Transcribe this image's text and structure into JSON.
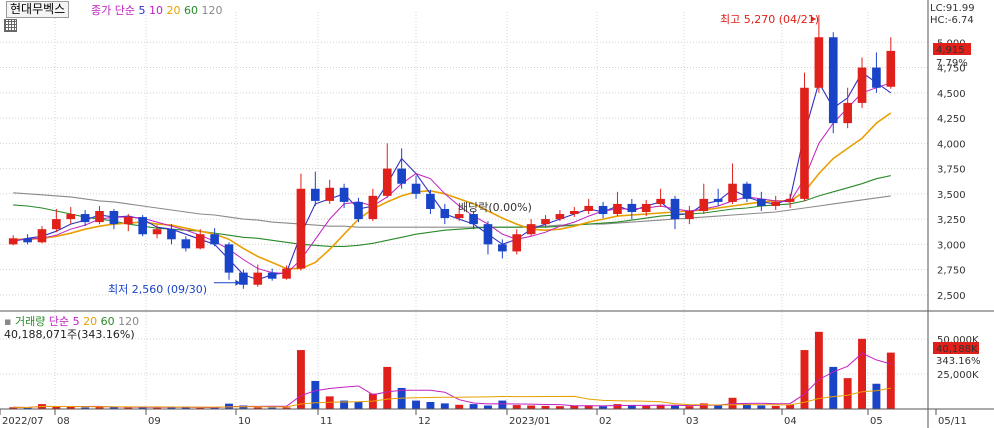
{
  "stock_name": "현대무벡스",
  "price_legend": {
    "type_label": "종가 단순",
    "periods": [
      "5",
      "10",
      "20",
      "60",
      "120"
    ]
  },
  "volume_legend": {
    "name": "거래량",
    "type_label": "단순",
    "periods": [
      "5",
      "20",
      "60",
      "120"
    ]
  },
  "volume_summary": "40,188,071주(343.16%)",
  "lc_label": "LC:91.99",
  "hc_label": "HC:-6.74",
  "max_annotation": "최고 5,270 (04/21)",
  "min_annotation": "최저 2,560 (09/30)",
  "ref_annotation": "배당락(0.00%)",
  "current_price_tag": "4,915",
  "current_change_tag": "7.79%",
  "current_volume_tag": "40,188K",
  "current_volume_ratio_tag": "343.16%",
  "colors": {
    "up": "#e0201b",
    "down": "#1a44c8",
    "ma5": "#3030c0",
    "ma10": "#c020c0",
    "ma20": "#e8a000",
    "ma60": "#2a8a2a",
    "ma120": "#8a8a8a"
  },
  "chart_data": [
    {
      "type": "candlestick",
      "ylim": [
        2350,
        5300
      ],
      "y_ticks": [
        "5,000",
        "4,750",
        "4,500",
        "4,250",
        "4,000",
        "3,750",
        "3,500",
        "3,250",
        "3,000",
        "2,750",
        "2,500"
      ],
      "y_tick_values": [
        5000,
        4750,
        4500,
        4250,
        4000,
        3750,
        3500,
        3250,
        3000,
        2750,
        2500
      ],
      "x_ticks": [
        "2022/07",
        "08",
        "09",
        "10",
        "11",
        "12",
        "2023/01",
        "02",
        "03",
        "04",
        "05",
        "05/11"
      ],
      "high": 5270,
      "low": 2560,
      "close": 4915,
      "series": [
        {
          "name": "5",
          "values": [
            3030,
            3060,
            3080,
            3130,
            3200,
            3240,
            3290,
            3270,
            3280,
            3250,
            3170,
            3150,
            3100,
            3050,
            3000,
            2850,
            2700,
            2650,
            2700,
            2720,
            3100,
            3400,
            3450,
            3500,
            3350,
            3380,
            3600,
            3850,
            3700,
            3500,
            3300,
            3250,
            3200,
            3100,
            3000,
            3050,
            3150,
            3200,
            3250,
            3300,
            3350,
            3320,
            3380,
            3330,
            3380,
            3420,
            3300,
            3300,
            3400,
            3430,
            3540,
            3470,
            3420,
            3400,
            3450,
            4100,
            4600,
            4350,
            4450,
            4700,
            4600,
            4500
          ]
        },
        {
          "name": "10",
          "values": [
            3040,
            3050,
            3060,
            3090,
            3150,
            3190,
            3250,
            3270,
            3270,
            3260,
            3220,
            3180,
            3140,
            3090,
            3030,
            2950,
            2850,
            2760,
            2720,
            2710,
            2850,
            3050,
            3250,
            3400,
            3420,
            3380,
            3470,
            3600,
            3700,
            3650,
            3500,
            3380,
            3280,
            3200,
            3100,
            3050,
            3080,
            3120,
            3180,
            3220,
            3280,
            3330,
            3350,
            3350,
            3360,
            3380,
            3350,
            3330,
            3350,
            3380,
            3430,
            3470,
            3450,
            3430,
            3420,
            3650,
            4000,
            4200,
            4350,
            4500,
            4550,
            4600
          ]
        }
      ],
      "moving_averages": {
        "ma5": [
          3030,
          3060,
          3080,
          3130,
          3200,
          3240,
          3290,
          3270,
          3280,
          3250,
          3170,
          3150,
          3100,
          3050,
          3000,
          2850,
          2700,
          2650,
          2700,
          2720,
          3100,
          3400,
          3450,
          3500,
          3350,
          3380,
          3600,
          3850,
          3700,
          3500,
          3300,
          3250,
          3200,
          3100,
          3000,
          3050,
          3150,
          3200,
          3250,
          3300,
          3350,
          3320,
          3380,
          3330,
          3380,
          3420,
          3300,
          3300,
          3400,
          3430,
          3540,
          3470,
          3420,
          3400,
          3450,
          4100,
          4600,
          4350,
          4450,
          4700,
          4600,
          4500
        ],
        "ma20": [
          3050,
          3050,
          3060,
          3080,
          3110,
          3150,
          3180,
          3200,
          3210,
          3220,
          3200,
          3190,
          3160,
          3130,
          3100,
          3050,
          2960,
          2880,
          2820,
          2760,
          2760,
          2820,
          2950,
          3100,
          3250,
          3350,
          3420,
          3480,
          3520,
          3530,
          3500,
          3450,
          3400,
          3330,
          3260,
          3200,
          3150,
          3140,
          3150,
          3180,
          3220,
          3250,
          3280,
          3290,
          3300,
          3310,
          3320,
          3330,
          3340,
          3360,
          3380,
          3400,
          3420,
          3430,
          3430,
          3520,
          3700,
          3850,
          3950,
          4050,
          4200,
          4300
        ],
        "ma60": [
          3390,
          3380,
          3360,
          3330,
          3300,
          3270,
          3250,
          3230,
          3200,
          3180,
          3160,
          3150,
          3140,
          3130,
          3110,
          3090,
          3070,
          3060,
          3040,
          3020,
          3000,
          2990,
          2980,
          2980,
          2990,
          3010,
          3040,
          3070,
          3100,
          3120,
          3140,
          3150,
          3160,
          3170,
          3170,
          3170,
          3170,
          3170,
          3180,
          3190,
          3200,
          3210,
          3220,
          3240,
          3260,
          3280,
          3290,
          3300,
          3310,
          3330,
          3350,
          3360,
          3380,
          3390,
          3400,
          3430,
          3480,
          3520,
          3560,
          3600,
          3650,
          3680
        ],
        "ma120": [
          3510,
          3500,
          3490,
          3480,
          3470,
          3450,
          3430,
          3420,
          3400,
          3380,
          3360,
          3340,
          3320,
          3300,
          3290,
          3270,
          3250,
          3240,
          3220,
          3210,
          3200,
          3190,
          3180,
          3180,
          3170,
          3170,
          3170,
          3170,
          3170,
          3170,
          3170,
          3170,
          3170,
          3170,
          3170,
          3170,
          3180,
          3180,
          3190,
          3190,
          3200,
          3200,
          3210,
          3220,
          3230,
          3240,
          3250,
          3260,
          3270,
          3280,
          3290,
          3300,
          3310,
          3320,
          3340,
          3360,
          3380,
          3400,
          3420,
          3440,
          3460,
          3480
        ]
      },
      "candles": [
        {
          "o": 3000,
          "c": 3060,
          "h": 3090,
          "l": 2990
        },
        {
          "o": 3060,
          "c": 3020,
          "h": 3100,
          "l": 3000
        },
        {
          "o": 3020,
          "c": 3150,
          "h": 3180,
          "l": 3010
        },
        {
          "o": 3150,
          "c": 3250,
          "h": 3350,
          "l": 3120
        },
        {
          "o": 3250,
          "c": 3300,
          "h": 3370,
          "l": 3200
        },
        {
          "o": 3300,
          "c": 3220,
          "h": 3340,
          "l": 3180
        },
        {
          "o": 3220,
          "c": 3330,
          "h": 3380,
          "l": 3200
        },
        {
          "o": 3330,
          "c": 3200,
          "h": 3350,
          "l": 3150
        },
        {
          "o": 3200,
          "c": 3270,
          "h": 3300,
          "l": 3130
        },
        {
          "o": 3270,
          "c": 3100,
          "h": 3290,
          "l": 3080
        },
        {
          "o": 3100,
          "c": 3150,
          "h": 3190,
          "l": 3060
        },
        {
          "o": 3150,
          "c": 3050,
          "h": 3200,
          "l": 3000
        },
        {
          "o": 3050,
          "c": 2960,
          "h": 3080,
          "l": 2930
        },
        {
          "o": 2960,
          "c": 3100,
          "h": 3150,
          "l": 2950
        },
        {
          "o": 3100,
          "c": 3000,
          "h": 3160,
          "l": 2980
        },
        {
          "o": 3000,
          "c": 2720,
          "h": 3020,
          "l": 2650
        },
        {
          "o": 2720,
          "c": 2600,
          "h": 2750,
          "l": 2560
        },
        {
          "o": 2600,
          "c": 2720,
          "h": 2800,
          "l": 2580
        },
        {
          "o": 2720,
          "c": 2660,
          "h": 2760,
          "l": 2640
        },
        {
          "o": 2660,
          "c": 2760,
          "h": 2790,
          "l": 2650
        },
        {
          "o": 2760,
          "c": 3550,
          "h": 3700,
          "l": 2740
        },
        {
          "o": 3550,
          "c": 3430,
          "h": 3720,
          "l": 3380
        },
        {
          "o": 3430,
          "c": 3560,
          "h": 3640,
          "l": 3400
        },
        {
          "o": 3560,
          "c": 3420,
          "h": 3600,
          "l": 3360
        },
        {
          "o": 3420,
          "c": 3250,
          "h": 3460,
          "l": 3220
        },
        {
          "o": 3250,
          "c": 3480,
          "h": 3550,
          "l": 3230
        },
        {
          "o": 3480,
          "c": 3750,
          "h": 4000,
          "l": 3460
        },
        {
          "o": 3750,
          "c": 3600,
          "h": 3950,
          "l": 3550
        },
        {
          "o": 3600,
          "c": 3500,
          "h": 3680,
          "l": 3450
        },
        {
          "o": 3500,
          "c": 3350,
          "h": 3540,
          "l": 3300
        },
        {
          "o": 3350,
          "c": 3260,
          "h": 3400,
          "l": 3200
        },
        {
          "o": 3260,
          "c": 3300,
          "h": 3360,
          "l": 3230
        },
        {
          "o": 3300,
          "c": 3200,
          "h": 3330,
          "l": 3150
        },
        {
          "o": 3200,
          "c": 3000,
          "h": 3230,
          "l": 2900
        },
        {
          "o": 3000,
          "c": 2930,
          "h": 3050,
          "l": 2860
        },
        {
          "o": 2930,
          "c": 3100,
          "h": 3150,
          "l": 2900
        },
        {
          "o": 3100,
          "c": 3200,
          "h": 3250,
          "l": 3080
        },
        {
          "o": 3200,
          "c": 3250,
          "h": 3290,
          "l": 3170
        },
        {
          "o": 3250,
          "c": 3300,
          "h": 3340,
          "l": 3230
        },
        {
          "o": 3300,
          "c": 3330,
          "h": 3370,
          "l": 3270
        },
        {
          "o": 3330,
          "c": 3380,
          "h": 3450,
          "l": 3300
        },
        {
          "o": 3380,
          "c": 3300,
          "h": 3420,
          "l": 3260
        },
        {
          "o": 3300,
          "c": 3400,
          "h": 3520,
          "l": 3280
        },
        {
          "o": 3400,
          "c": 3320,
          "h": 3450,
          "l": 3250
        },
        {
          "o": 3320,
          "c": 3400,
          "h": 3440,
          "l": 3280
        },
        {
          "o": 3400,
          "c": 3450,
          "h": 3550,
          "l": 3370
        },
        {
          "o": 3450,
          "c": 3250,
          "h": 3480,
          "l": 3150
        },
        {
          "o": 3250,
          "c": 3330,
          "h": 3380,
          "l": 3200
        },
        {
          "o": 3330,
          "c": 3450,
          "h": 3600,
          "l": 3300
        },
        {
          "o": 3450,
          "c": 3420,
          "h": 3550,
          "l": 3380
        },
        {
          "o": 3420,
          "c": 3600,
          "h": 3800,
          "l": 3400
        },
        {
          "o": 3600,
          "c": 3450,
          "h": 3620,
          "l": 3420
        },
        {
          "o": 3450,
          "c": 3380,
          "h": 3520,
          "l": 3330
        },
        {
          "o": 3380,
          "c": 3420,
          "h": 3480,
          "l": 3340
        },
        {
          "o": 3420,
          "c": 3450,
          "h": 3500,
          "l": 3360
        },
        {
          "o": 3450,
          "c": 4550,
          "h": 4700,
          "l": 3430
        },
        {
          "o": 4550,
          "c": 5050,
          "h": 5270,
          "l": 4500
        },
        {
          "o": 5050,
          "c": 4200,
          "h": 5100,
          "l": 4100
        },
        {
          "o": 4200,
          "c": 4400,
          "h": 4550,
          "l": 4150
        },
        {
          "o": 4400,
          "c": 4750,
          "h": 4850,
          "l": 4350
        },
        {
          "o": 4750,
          "c": 4550,
          "h": 4900,
          "l": 4500
        },
        {
          "o": 4560,
          "c": 4915,
          "h": 5050,
          "l": 4540
        }
      ]
    },
    {
      "type": "bar",
      "name": "거래량",
      "ylim": [
        0,
        62000
      ],
      "y_ticks": [
        "50,000K",
        "25,000K"
      ],
      "y_tick_values": [
        50000,
        25000
      ],
      "values": [
        1200,
        900,
        3500,
        1500,
        1800,
        1100,
        1400,
        1300,
        1000,
        1600,
        900,
        1100,
        1300,
        800,
        1000,
        3800,
        2500,
        1200,
        1000,
        1100,
        42000,
        20000,
        9000,
        6000,
        5000,
        11000,
        30000,
        15000,
        6000,
        5000,
        4000,
        3000,
        3500,
        2500,
        6000,
        2800,
        2500,
        2200,
        2000,
        2400,
        2600,
        2000,
        3500,
        2500,
        2200,
        3000,
        2400,
        2000,
        4000,
        2600,
        8000,
        3500,
        2500,
        2200,
        3000,
        42000,
        55000,
        30000,
        22000,
        50000,
        18000,
        40188
      ]
    }
  ]
}
